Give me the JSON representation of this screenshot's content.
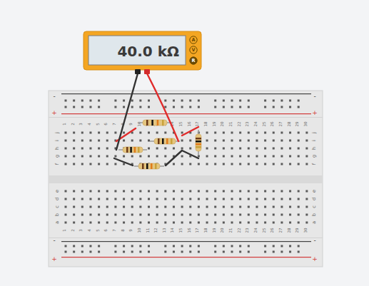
{
  "meter": {
    "reading": "40.0 kΩ",
    "modes": [
      {
        "label": "A",
        "selected": false
      },
      {
        "label": "V",
        "selected": false
      },
      {
        "label": "R",
        "selected": true
      }
    ]
  },
  "breadboard": {
    "columns": [
      "1",
      "2",
      "3",
      "4",
      "5",
      "6",
      "7",
      "8",
      "9",
      "10",
      "11",
      "12",
      "13",
      "14",
      "15",
      "16",
      "17",
      "18",
      "19",
      "20",
      "21",
      "22",
      "23",
      "24",
      "25",
      "26",
      "27",
      "28",
      "29",
      "30"
    ],
    "rows_top": [
      "j",
      "i",
      "h",
      "g",
      "f"
    ],
    "rows_bottom": [
      "e",
      "d",
      "c",
      "b",
      "a"
    ],
    "rail_minus": "-",
    "rail_plus": "+"
  },
  "resistors": [
    {
      "bands": [
        "#6b3a1a",
        "#111111",
        "#e07b1a",
        "#c9a23a"
      ]
    },
    {
      "bands": [
        "#6b3a1a",
        "#111111",
        "#e07b1a",
        "#c9a23a"
      ]
    },
    {
      "bands": [
        "#6b3a1a",
        "#111111",
        "#e07b1a",
        "#c9a23a"
      ]
    },
    {
      "bands": [
        "#6b3a1a",
        "#111111",
        "#e07b1a",
        "#c9a23a"
      ]
    },
    {
      "bands": [
        "#6b3a1a",
        "#111111",
        "#e07b1a",
        "#c9a23a"
      ]
    }
  ],
  "wires": [
    {
      "color": "#e02b2b"
    },
    {
      "color": "#e02b2b"
    },
    {
      "color": "#333333"
    },
    {
      "color": "#333333"
    },
    {
      "color": "#333333"
    },
    {
      "color": "#e02b2b"
    }
  ]
}
